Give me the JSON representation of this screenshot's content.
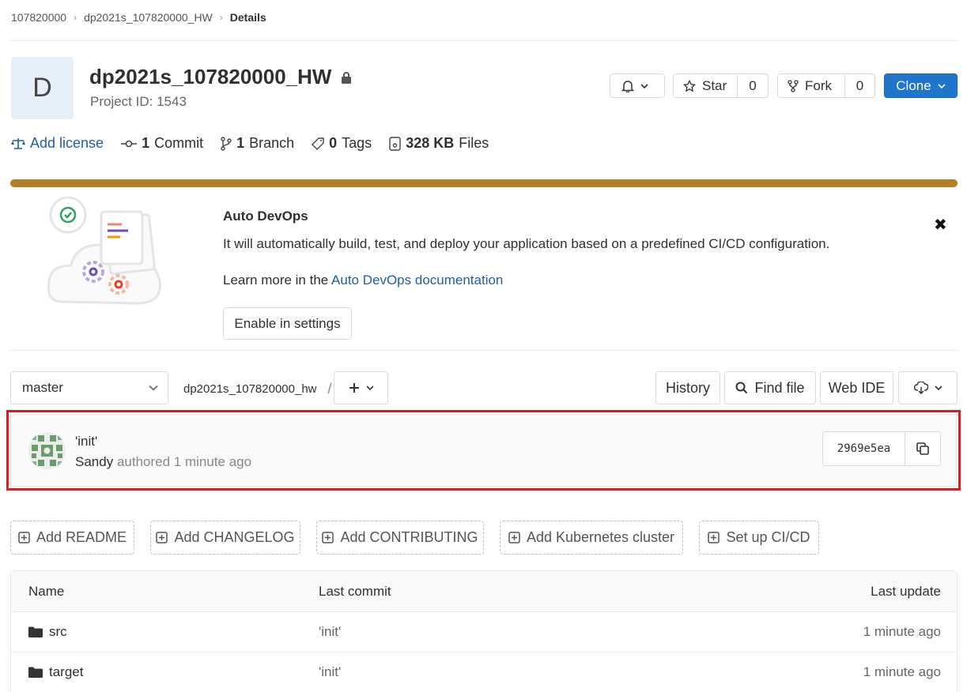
{
  "breadcrumb": {
    "group": "107820000",
    "project": "dp2021s_107820000_HW",
    "current": "Details"
  },
  "project": {
    "avatar_letter": "D",
    "name": "dp2021s_107820000_HW",
    "id_text": "Project ID: 1543"
  },
  "actions": {
    "star_label": "Star",
    "star_count": "0",
    "fork_label": "Fork",
    "fork_count": "0",
    "clone_label": "Clone"
  },
  "stats": {
    "add_license": "Add license",
    "commit_count": "1",
    "commit_label": "Commit",
    "branch_count": "1",
    "branch_label": "Branch",
    "tag_count": "0",
    "tag_label": "Tags",
    "files_size": "328 KB",
    "files_label": "Files"
  },
  "devops": {
    "title": "Auto DevOps",
    "description": "It will automatically build, test, and deploy your application based on a predefined CI/CD configuration.",
    "learn_prefix": "Learn more in the ",
    "learn_link": "Auto DevOps documentation",
    "enable_button": "Enable in settings",
    "accent_color": "#b37e26"
  },
  "toolbar": {
    "branch": "master",
    "path": "dp2021s_107820000_hw",
    "path_sep": "/",
    "history": "History",
    "find_file": "Find file",
    "web_ide": "Web IDE"
  },
  "last_commit": {
    "message": "'init'",
    "author": "Sandy",
    "meta": "authored 1 minute ago",
    "sha": "2969e5ea",
    "highlight_color": "#d42020"
  },
  "quick_add": [
    "Add README",
    "Add CHANGELOG",
    "Add CONTRIBUTING",
    "Add Kubernetes cluster",
    "Set up CI/CD"
  ],
  "files": {
    "headers": {
      "name": "Name",
      "last_commit": "Last commit",
      "last_update": "Last update"
    },
    "rows": [
      {
        "name": "src",
        "commit": "'init'",
        "updated": "1 minute ago"
      },
      {
        "name": "target",
        "commit": "'init'",
        "updated": "1 minute ago"
      }
    ]
  }
}
